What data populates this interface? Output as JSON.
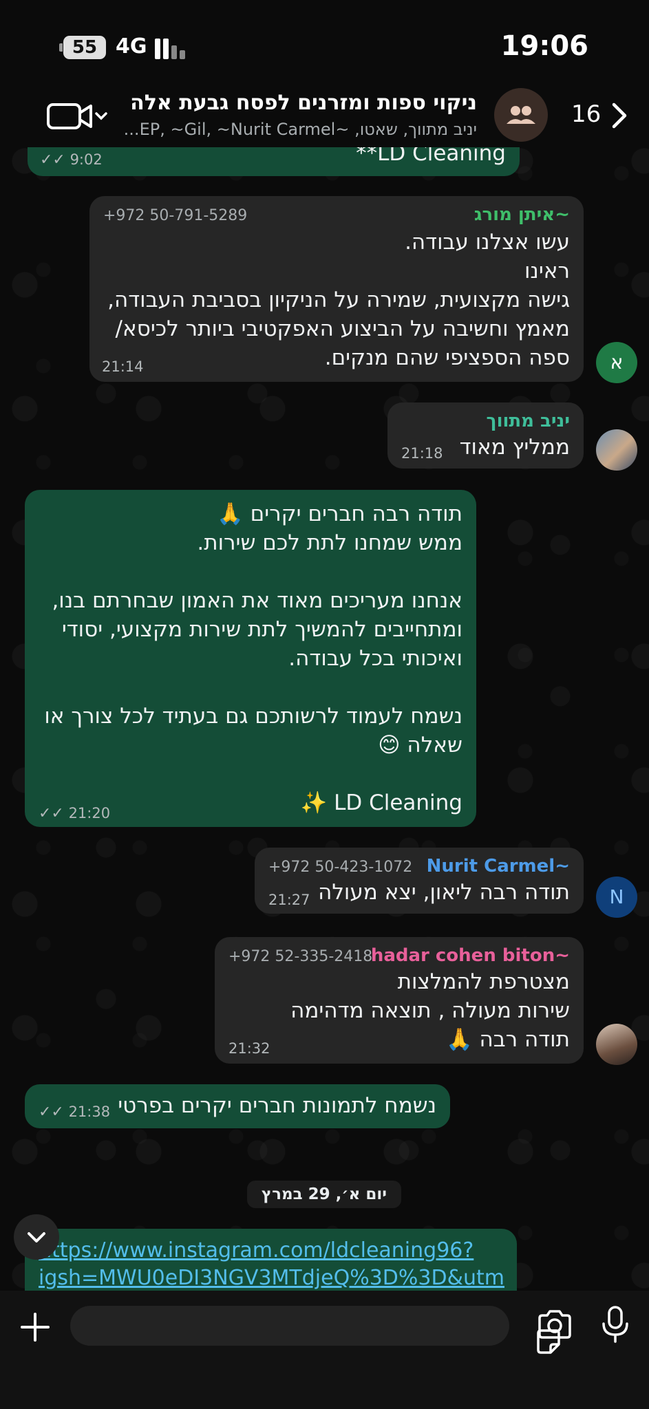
{
  "status_bar": {
    "battery": "55",
    "network": "4G",
    "time": "19:06"
  },
  "header": {
    "title": "ניקוי ספות ומזרנים לפסח גבעת אלה",
    "subtitle": "יניב מתווך, שאטו, ~EP, ~Gil, ~Nurit Carmel...",
    "back_count": "16"
  },
  "messages": {
    "m0": {
      "text": "LD Cleaning**",
      "time": "9:02"
    },
    "m1": {
      "sender": "~איתן מורג",
      "phone": "+972 50-791-5289",
      "avatar_letter": "א",
      "text": "עשו אצלנו עבודה.\nראינו\nגישה מקצועית, שמירה על הניקיון בסביבת העבודה,\nמאמץ וחשיבה על הביצוע האפקטיבי ביותר לכיסא/\nספה הספציפי שהם מנקים.",
      "time": "21:14"
    },
    "m2": {
      "sender": "יניב מתווך",
      "text": "ממליץ מאוד",
      "time": "21:18"
    },
    "m3": {
      "text": "תודה רבה חברים יקרים 🙏\nממש שמחנו לתת לכם שירות.\n\nאנחנו מעריכים מאוד את האמון שבחרתם בנו,\nומתחייבים להמשיך לתת שירות מקצועי, יסודי\nואיכותי בכל עבודה.\n\nנשמח לעמוד לרשותכם גם בעתיד לכל צורך או\nשאלה 😊\n\nLD Cleaning ✨",
      "time": "21:20"
    },
    "m4": {
      "sender": "~Nurit Carmel",
      "phone": "+972 50-423-1072",
      "avatar_letter": "N",
      "text": "תודה רבה ליאון, יצא מעולה",
      "time": "21:27"
    },
    "m5": {
      "sender": "~hadar cohen biton",
      "phone": "+972 52-335-2418",
      "text": "מצטרפת להמלצות\nשירות מעולה , תוצאה מדהימה\nתודה רבה 🙏",
      "time": "21:32"
    },
    "m6": {
      "text": "נשמח לתמונות חברים יקרים בפרטי",
      "time": "21:38"
    }
  },
  "date_divider": "יום א׳, 29 במרץ",
  "link": {
    "line1": "https://www.instagram.com/ldcleaning96?",
    "line2": "igsh=MWU0eDI3NGV3MTdjeQ%3D%3D&utm"
  },
  "composer": {
    "placeholder": ""
  },
  "colors": {
    "outgoing_bubble": "#144d37",
    "incoming_bubble": "#262626",
    "sender_eitan": "#3fbe6a",
    "sender_yaniv": "#3fbe9a",
    "sender_nurit": "#4d9be8",
    "sender_hadar": "#e8609a",
    "link": "#53bdeb"
  },
  "icons": [
    "video-call-icon",
    "chevron-down-icon",
    "group-avatar-icon",
    "back-chevron-icon",
    "double-check-icon",
    "scroll-down-chevron-icon",
    "plus-icon",
    "sticker-icon",
    "camera-icon",
    "microphone-icon"
  ]
}
